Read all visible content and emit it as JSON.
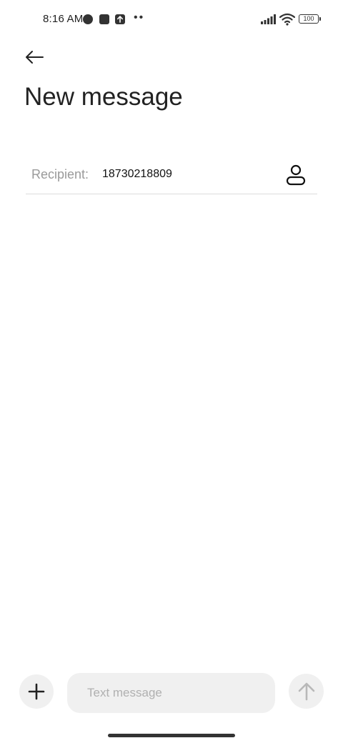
{
  "status_bar": {
    "time": "8:16 AM",
    "more_dots": "••",
    "battery_level": "100",
    "icons": [
      "notification-circle-icon",
      "square-app-icon",
      "upload-icon",
      "signal-icon",
      "wifi-icon",
      "battery-icon"
    ]
  },
  "header": {
    "back_icon": "arrow-left-icon",
    "title": "New message"
  },
  "recipient": {
    "label": "Recipient:",
    "value": "18730218809",
    "contact_icon": "person-icon"
  },
  "compose": {
    "attach_icon": "plus-icon",
    "placeholder": "Text message",
    "send_icon": "arrow-up-icon"
  },
  "colors": {
    "background": "#ffffff",
    "input_fill": "#f0f0f0",
    "placeholder": "#b0b0b0",
    "label_gray": "#9a9a9a",
    "divider": "#dcdcdc"
  }
}
